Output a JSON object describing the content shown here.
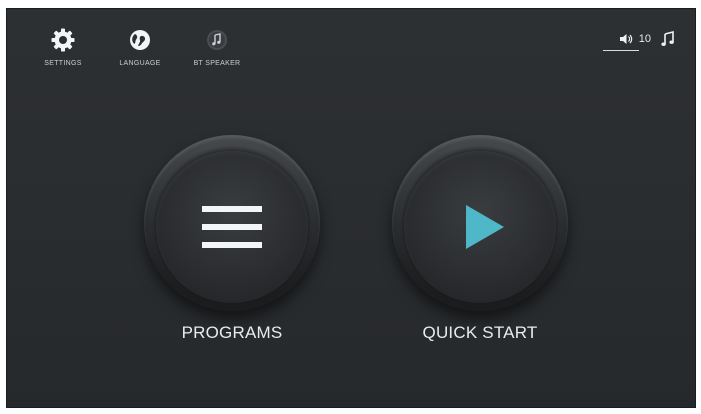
{
  "top_menu": {
    "settings": {
      "label": "SETTINGS",
      "icon": "gear-icon"
    },
    "language": {
      "label": "LANGUAGE",
      "icon": "globe-icon"
    },
    "bt_speaker": {
      "label": "BT SPEAKER",
      "icon": "bluetooth-music-icon"
    }
  },
  "status": {
    "volume_icon": "speaker-icon",
    "volume_level": "10",
    "music_icon": "music-note-icon"
  },
  "main": {
    "programs": {
      "label": "PROGRAMS",
      "icon": "menu-lines-icon"
    },
    "quick_start": {
      "label": "QUICK START",
      "icon": "play-icon"
    }
  },
  "colors": {
    "background": "#2a2d30",
    "play_accent": "#4fb8c8",
    "text": "#e9ebed"
  }
}
